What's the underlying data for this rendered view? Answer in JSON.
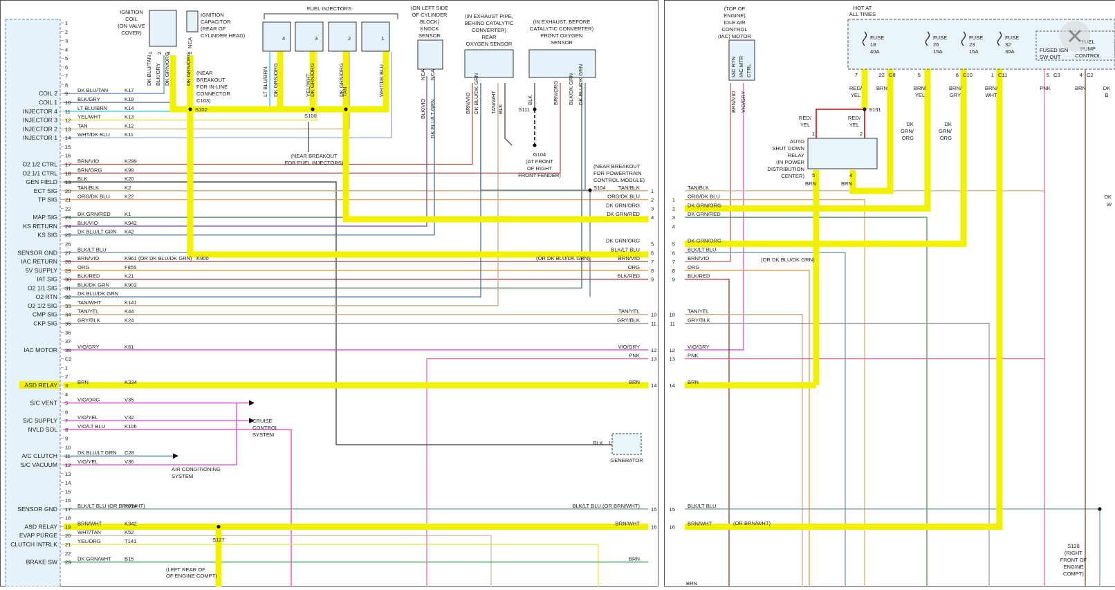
{
  "left_panel": {
    "pcm_left_labels": [
      {
        "text": "COIL 2",
        "row": 9
      },
      {
        "text": "COIL 1",
        "row": 10
      },
      {
        "text": "INJECTOR 4",
        "row": 11
      },
      {
        "text": "INJECTOR 3",
        "row": 12
      },
      {
        "text": "INJECTOR 2",
        "row": 13
      },
      {
        "text": "INJECTOR 1",
        "row": 14
      },
      {
        "text": "O2 1/2 CTRL",
        "row": 17
      },
      {
        "text": "O2 1/1 CTRL",
        "row": 18
      },
      {
        "text": "GEN FIELD",
        "row": 19
      },
      {
        "text": "ECT SIG",
        "row": 20
      },
      {
        "text": "TP SIG",
        "row": 21
      },
      {
        "text": "MAP SIG",
        "row": 23
      },
      {
        "text": "KS RETURN",
        "row": 24
      },
      {
        "text": "KS SIG",
        "row": 25
      },
      {
        "text": "SENSOR GND",
        "row": 27
      },
      {
        "text": "IAC RETURN",
        "row": 28
      },
      {
        "text": "5V SUPPLY",
        "row": 29
      },
      {
        "text": "IAT SIG",
        "row": 30
      },
      {
        "text": "O2 1/1 SIG",
        "row": 31
      },
      {
        "text": "O2 RTN",
        "row": 32
      },
      {
        "text": "O2 1/2 SIG",
        "row": 33
      },
      {
        "text": "CMP SIG",
        "row": 34
      },
      {
        "text": "CKP SIG",
        "row": 35
      },
      {
        "text": "IAC MOTOR",
        "row": 38
      },
      {
        "text": "ASD RELAY",
        "row": 42,
        "highlight": true
      },
      {
        "text": "S/C VENT",
        "row": 44
      },
      {
        "text": "S/C SUPPLY",
        "row": 46
      },
      {
        "text": "NVLD SOL",
        "row": 47
      },
      {
        "text": "A/C CLUTCH",
        "row": 50
      },
      {
        "text": "S/C VACUUM",
        "row": 51
      },
      {
        "text": "SENSOR GND",
        "row": 56
      },
      {
        "text": "ASD RELAY",
        "row": 58
      },
      {
        "text": "EVAP PURGE",
        "row": 59
      },
      {
        "text": "CLUTCH INTRLK",
        "row": 60
      },
      {
        "text": "BRAKE SW",
        "row": 62
      }
    ],
    "pin_numbers": [
      "1",
      "2",
      "3",
      "4",
      "5",
      "6",
      "7",
      "8",
      "9",
      "10",
      "11",
      "12",
      "13",
      "14",
      "15",
      "16",
      "17",
      "18",
      "19",
      "20",
      "21",
      "22",
      "23",
      "24",
      "25",
      "26",
      "27",
      "28",
      "29",
      "30",
      "31",
      "32",
      "33",
      "34",
      "35",
      "36",
      "37",
      "38",
      "C2",
      "1",
      "2",
      "3",
      "4",
      "5",
      "6",
      "7",
      "8",
      "9",
      "10",
      "11",
      "12",
      "13",
      "14",
      "15",
      "16",
      "17",
      "18",
      "19",
      "20",
      "21",
      "22",
      "23"
    ],
    "wires": [
      {
        "row": 9,
        "color": "DK BLU/TAN",
        "circuit": "K17",
        "stroke": "#6b8ebc"
      },
      {
        "row": 10,
        "color": "BLK/GRY",
        "circuit": "K19",
        "stroke": "#4c5f8c"
      },
      {
        "row": 11,
        "color": "LT BLU/BRN",
        "circuit": "K14",
        "stroke": "#35c6c6"
      },
      {
        "row": 12,
        "color": "YEL/WHT",
        "circuit": "K13",
        "stroke": "#e8e040"
      },
      {
        "row": 13,
        "color": "TAN",
        "circuit": "K12",
        "stroke": "#c9a77e"
      },
      {
        "row": 14,
        "color": "WHT/DK BLU",
        "circuit": "K11",
        "stroke": "#9aa6c4"
      },
      {
        "row": 17,
        "color": "BRN/VIO",
        "circuit": "K299",
        "stroke": "#b0584c"
      },
      {
        "row": 18,
        "color": "BRN/ORG",
        "circuit": "K99",
        "stroke": "#b0584c"
      },
      {
        "row": 19,
        "color": "BLK",
        "circuit": "K20",
        "stroke": "#3a3a3a"
      },
      {
        "row": 20,
        "color": "TAN/BLK",
        "circuit": "K2",
        "stroke": "#c9a77e"
      },
      {
        "row": 21,
        "color": "ORG/DK BLU",
        "circuit": "K22",
        "stroke": "#e2a35c"
      },
      {
        "row": 23,
        "color": "DK GRN/RED",
        "circuit": "K1",
        "stroke": "#3c8a4a"
      },
      {
        "row": 24,
        "color": "BLK/VIO",
        "circuit": "K942",
        "stroke": "#7a4aa8"
      },
      {
        "row": 25,
        "color": "DK BLU/LT GRN",
        "circuit": "K42",
        "stroke": "#4a6fa8"
      },
      {
        "row": 27,
        "color": "BLK/LT BLU",
        "circuit": "",
        "stroke": "#6e8fa6"
      },
      {
        "row": 28,
        "color": "BRN/VIO",
        "circuit": "K961",
        "stroke": "#b0584c"
      },
      {
        "row": 29,
        "color": "ORG",
        "circuit": "F855",
        "stroke": "#f08a24"
      },
      {
        "row": 30,
        "color": "BLK/RED",
        "circuit": "K21",
        "stroke": "#8a2a2a"
      },
      {
        "row": 31,
        "color": "BLK/DK GRN",
        "circuit": "K902",
        "stroke": "#3c6a4a"
      },
      {
        "row": 32,
        "color": "DK BLU/DK GRN",
        "circuit": "",
        "stroke": "#4a6f8a"
      },
      {
        "row": 33,
        "color": "TAN/WHT",
        "circuit": "K141",
        "stroke": "#c9a77e"
      },
      {
        "row": 34,
        "color": "TAN/YEL",
        "circuit": "K44",
        "stroke": "#c9a77e"
      },
      {
        "row": 35,
        "color": "GRY/BLK",
        "circuit": "K24",
        "stroke": "#9a9a9a"
      },
      {
        "row": 38,
        "color": "VIO/GRY",
        "circuit": "K61",
        "stroke": "#e040d0"
      },
      {
        "row": 42,
        "color": "BRN",
        "circuit": "K334",
        "stroke": "#8a5a2a"
      },
      {
        "row": 44,
        "color": "VIO/ORG",
        "circuit": "V35",
        "stroke": "#e040d0"
      },
      {
        "row": 46,
        "color": "VIO/YEL",
        "circuit": "V32",
        "stroke": "#e040d0"
      },
      {
        "row": 47,
        "color": "VIO/LT BLU",
        "circuit": "K106",
        "stroke": "#e040d0"
      },
      {
        "row": 50,
        "color": "DK BLU/LT GRN",
        "circuit": "C28",
        "stroke": "#4a6fa8"
      },
      {
        "row": 51,
        "color": "VIO/YEL",
        "circuit": "V36",
        "stroke": "#e040d0"
      },
      {
        "row": 56,
        "color": "BLK/LT BLU (OR BRN/WHT)",
        "circuit": "K914",
        "stroke": "#6e9a9a"
      },
      {
        "row": 58,
        "color": "BRN/WHT",
        "circuit": "K342",
        "stroke": "#8a5a2a"
      },
      {
        "row": 59,
        "color": "WHT/TAN",
        "circuit": "K52",
        "stroke": "#c9c0a8"
      },
      {
        "row": 60,
        "color": "YEL/ORG",
        "circuit": "T141",
        "stroke": "#e8e040"
      },
      {
        "row": 62,
        "color": "DK GRN/WHT",
        "circuit": "B15",
        "stroke": "#3c8a4a"
      }
    ],
    "right_labels": [
      {
        "text": "TAN/BLK",
        "pin": "1",
        "row": 20
      },
      {
        "text": "ORG/DK BLU",
        "pin": "2",
        "row": 21
      },
      {
        "text": "DK GRN/ORG",
        "pin": "3",
        "row": 22
      },
      {
        "text": "DK GRN/RED",
        "pin": "4",
        "row": 23
      },
      {
        "text": "DK GRN/ORG",
        "pin": "5",
        "row": 26
      },
      {
        "text": "BLK/LT BLU",
        "pin": "6",
        "row": 27
      },
      {
        "text": "BRN/VIO",
        "pin": "7",
        "row": 28
      },
      {
        "text": "ORG",
        "pin": "8",
        "row": 29
      },
      {
        "text": "BLK/RED",
        "pin": "9",
        "row": 30
      },
      {
        "text": "TAN/YEL",
        "pin": "10",
        "row": 34
      },
      {
        "text": "GRY/BLK",
        "pin": "11",
        "row": 35
      },
      {
        "text": "VIO/GRY",
        "pin": "12",
        "row": 38
      },
      {
        "text": "PNK",
        "pin": "13",
        "row": 39
      },
      {
        "text": "BRN",
        "pin": "14",
        "row": 42
      },
      {
        "text": "BLK/LT BLU (OR BRN/WHT)",
        "pin": "15",
        "row": 56
      },
      {
        "text": "BRN/WHT",
        "pin": "16",
        "row": 58
      },
      {
        "text": "BRN",
        "pin": "",
        "row": 62
      }
    ],
    "misc": {
      "k900": "K900",
      "or_dk_blu_dk_grn_1": "(OR DK BLU/DK GRN)",
      "or_dk_blu_dk_grn_2": "(OR DK BLU/DK GRN)",
      "cruise": [
        "CRUISE",
        "CONTROL",
        "SYSTEM"
      ],
      "ac": [
        "AIR CONDITIONING",
        "SYSTEM"
      ],
      "generator": "GENERATOR",
      "gen_wire": "BLK",
      "gen_pin": "1",
      "s127": "S127",
      "s127_note": [
        "(LEFT REAR OF",
        "OF ENGINE COMPT)"
      ]
    },
    "top": {
      "ignition_coil": [
        "IGNITION",
        "COIL",
        "(ON VALVE",
        "COVER)"
      ],
      "ignition_capacitor": [
        "IGNITION",
        "CAPACITOR",
        "(REAR OF",
        "CYLINDER HEAD)"
      ],
      "coil_wires": [
        "DK BLU/TAN",
        "BLK/GRY",
        "DK GRN/ORG",
        "DK GRN/ORG"
      ],
      "coil_pins": [
        "1",
        "2",
        "3",
        "1"
      ],
      "capacitor_nca": "NCA",
      "s102_note": [
        "(NEAR",
        "BREAKOUT",
        "FOR IN-LINE",
        "CONNECTOR",
        "C103)"
      ],
      "s102": "S102",
      "fuel_injectors": "FUEL INJECTORS",
      "injector_numbers": [
        "4",
        "3",
        "2",
        "1"
      ],
      "injector_wires": [
        "LT BLU/BRN",
        "DK GRN/ORG",
        "YEL/WHT",
        "DK GRN/ORG",
        "TAN",
        "DK GRN/ORG",
        "WHT/DK BLU"
      ],
      "s100": "S100",
      "s100_note": [
        "(NEAR BREAKOUT",
        "FOR FUEL INJECTORS)"
      ],
      "knock_sensor": [
        "(ON LEFT SIDE",
        "OF CYLINDER",
        "BLOCK)",
        "KNOCK",
        "SENSOR"
      ],
      "knock_wires": [
        "BLK/VIO",
        "DK BLU/LT GRN"
      ],
      "knock_nca": [
        "NCA",
        "NCA"
      ],
      "rear_o2": [
        "(IN EXHAUST PIPE,",
        "BEHIND CATALYTIC",
        "CONVERTER)",
        "REAR",
        "OXYGEN SENSOR"
      ],
      "rear_o2_wires": [
        "BRN/VIO",
        "DK BLU/DK GRN",
        "TAN/WHT",
        "BLK"
      ],
      "front_o2": [
        "(IN EXHAUST, BEFORE",
        "CATALYTIC CONVERTER)",
        "FRONT OXYGEN",
        "SENSOR"
      ],
      "front_o2_wires": [
        "BLK",
        "BRN/ORG",
        "BLK/DK GRN",
        "DK BLU/DK GRN"
      ],
      "s111": "S111",
      "g104": [
        "G104",
        "(AT FRONT",
        "OF RIGHT",
        "FRONT FENDER)"
      ],
      "s104": "S104",
      "s104_note": [
        "(NEAR BREAKOUT",
        "FOR POWERTRAIN",
        "CONTROL MODULE)"
      ]
    }
  },
  "right_panel": {
    "iac": [
      "(TOP OF",
      "ENGINE)",
      "IDLE AIR",
      "CONTROL",
      "(IAC) MOTOR"
    ],
    "iac_pins": [
      "IAC RTN",
      "IAC MTR",
      "CTRL"
    ],
    "iac_wires": [
      "BRN/VIO",
      "VIO/GRY"
    ],
    "hot_at_all_times": [
      "HOT AT",
      "ALL TIMES"
    ],
    "fuses": [
      {
        "label": "FUSE",
        "num": "18",
        "amp": "40A"
      },
      {
        "label": "FUSE",
        "num": "26",
        "amp": "15A"
      },
      {
        "label": "FUSE",
        "num": "23",
        "amp": "15A"
      },
      {
        "label": "FUSE",
        "num": "32",
        "amp": "30A"
      }
    ],
    "fused_ign": [
      "FUSED IGN",
      "SW OUT"
    ],
    "fuel_pump": [
      "FUEL",
      "PUMP",
      "CONTROL"
    ],
    "pdc_pins": [
      {
        "pin": "7",
        "conn": ""
      },
      {
        "pin": "22",
        "conn": "C8"
      },
      {
        "pin": "5",
        "conn": ""
      },
      {
        "pin": "6",
        "conn": "C10"
      },
      {
        "pin": "1",
        "conn": "C11"
      },
      {
        "pin": "5",
        "conn": "C3"
      },
      {
        "pin": "4",
        "conn": "C2"
      }
    ],
    "top_wire_labels": [
      "RED/ YEL",
      "BRN",
      "BRN/ YEL",
      "BRN/ GRY",
      "BRN/ WHT",
      "PNK",
      "BRN",
      "DK B"
    ],
    "s131": "S131",
    "relay_wire_labels": [
      "RED/ YEL",
      "RED/ YEL"
    ],
    "relay_pins": [
      "1",
      "2",
      "5",
      "4"
    ],
    "asd_relay": [
      "AUTO",
      "SHUT DOWN",
      "RELAY",
      "(IN POWER",
      "DISTRIBUTION",
      "CENTER)"
    ],
    "relay_out_labels": [
      "BRN",
      "BRN"
    ],
    "dk_grn_labels": [
      "DK GRN/ ORG",
      "DK GRN/ ORG"
    ],
    "harness_rows": [
      {
        "pin": "",
        "label": "TAN/BLK",
        "row": 20
      },
      {
        "pin": "1",
        "label": "ORG/DK BLU",
        "row": 21
      },
      {
        "pin": "2",
        "label": "DK GRN/ORG",
        "row": 22
      },
      {
        "pin": "3",
        "label": "DK GRN/RED",
        "row": 23
      },
      {
        "pin": "4",
        "label": "",
        "row": 24
      },
      {
        "pin": "5",
        "label": "DK GRN/ORG",
        "row": 26
      },
      {
        "pin": "6",
        "label": "BLK/LT BLU",
        "row": 27
      },
      {
        "pin": "7",
        "label": "BRN/VIO",
        "row": 28
      },
      {
        "pin": "8",
        "label": "ORG",
        "row": 29
      },
      {
        "pin": "9",
        "label": "BLK/RED",
        "row": 30
      },
      {
        "pin": "10",
        "label": "TAN/YEL",
        "row": 34
      },
      {
        "pin": "11",
        "label": "GRY/BLK",
        "row": 35
      },
      {
        "pin": "12",
        "label": "VIO/GRY",
        "row": 38
      },
      {
        "pin": "13",
        "label": "PNK",
        "row": 39
      },
      {
        "pin": "14",
        "label": "BRN",
        "row": 42
      },
      {
        "pin": "15",
        "label": "BLK/LT BLU",
        "row": 56
      },
      {
        "pin": "16",
        "label": "BRN/WHT",
        "row": 58
      }
    ],
    "or_dk_blu_dk_grn": "(OR DK BLU/DK GRN)",
    "or_brn_wht": "(OR BRN/WHT)",
    "s128": [
      "S128",
      "(RIGHT",
      "FRONT OF",
      "ENGINE",
      "COMPT)"
    ],
    "dk_right_edge": [
      "DK",
      "W"
    ],
    "bottom_brn": "BRN"
  },
  "close_button": {
    "icon": "close-icon"
  },
  "colors": {
    "highlight": "#f2f200",
    "trace": "#22aa22",
    "red_trace": "#e02020",
    "pcm_fill": "#e6f2fa",
    "pdc_fill": "#eaf4fb"
  }
}
